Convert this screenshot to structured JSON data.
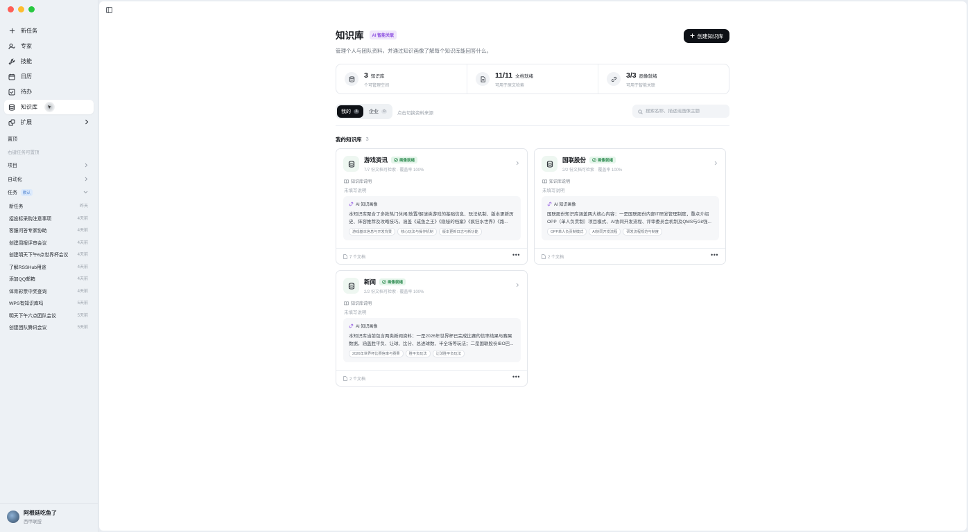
{
  "colors": {
    "accent": "#0e1116",
    "ai_purple": "#8a4ce0",
    "ready_green": "#2e8b50"
  },
  "sidebar": {
    "nav": [
      {
        "label": "新任务",
        "icon": "plus-icon"
      },
      {
        "label": "专家",
        "icon": "expert-icon"
      },
      {
        "label": "技能",
        "icon": "wrench-icon"
      },
      {
        "label": "日历",
        "icon": "calendar-icon"
      },
      {
        "label": "待办",
        "icon": "todo-check-icon"
      },
      {
        "label": "知识库",
        "icon": "database-icon",
        "active": true
      },
      {
        "label": "扩展",
        "icon": "extension-icon"
      }
    ],
    "pinned_label": "置顶",
    "pinned_hint": "右键任务可置顶",
    "projects_label": "项目",
    "automation_label": "自动化",
    "tasks_label": "任务",
    "tasks_badge": "默认",
    "tasks": [
      {
        "title": "新任务",
        "time": "昨天"
      },
      {
        "title": "招投标采购注意事项",
        "time": "4天前"
      },
      {
        "title": "客服问答专家协助",
        "time": "4天前"
      },
      {
        "title": "创建周报评审会议",
        "time": "4天前"
      },
      {
        "title": "创建明天下午6点世界杯会议",
        "time": "4天前"
      },
      {
        "title": "了解RSSHub用途",
        "time": "4天前"
      },
      {
        "title": "添加QQ邮箱",
        "time": "4天前"
      },
      {
        "title": "体育彩票中奖查询",
        "time": "4天前"
      },
      {
        "title": "WPS有知识库吗",
        "time": "5天前"
      },
      {
        "title": "明天下午六点团队会议",
        "time": "5天前"
      },
      {
        "title": "创建团队腾讯会议",
        "time": "5天前"
      }
    ],
    "user": {
      "name": "阿根廷吃鱼了",
      "org": "西甲联盟"
    }
  },
  "header": {
    "title": "知识库",
    "ai_badge": "AI 智能关联",
    "subtitle": "管理个人与团队资料，并通过知识画像了解每个知识库能回答什么。",
    "create_button": "创建知识库"
  },
  "stats": [
    {
      "num": "3",
      "label": "知识库",
      "sub": "个可管理空间",
      "icon": "database-icon"
    },
    {
      "num": "11/11",
      "label": "文档就绪",
      "sub": "可用于原文检索",
      "icon": "document-icon"
    },
    {
      "num": "3/3",
      "label": "画像就绪",
      "sub": "可用于智能关联",
      "icon": "link-icon"
    }
  ],
  "tabs": {
    "mine": {
      "label": "我的",
      "count": "3"
    },
    "enterprise": {
      "label": "企业",
      "count": "0"
    },
    "hint": "点击切换资料来源"
  },
  "search": {
    "placeholder": "搜索名称、描述或画像主题"
  },
  "section": {
    "title": "我的知识库",
    "count": "3"
  },
  "cards": [
    {
      "name": "游戏资讯",
      "status": "画像就绪",
      "meta": "7/7 份文档可检索 · 覆盖率 100%",
      "desc_label": "知识库说明",
      "desc": "未填写说明",
      "ai_label": "AI 知识画像",
      "summary": "本知识库聚合了多款热门休闲/放置/解谜类游戏的基础信息、玩法机制、版本更新历史、阵容推荐及攻略技巧。涵盖《咸鱼之王》《隐秘的档案》《疯狂水世界》《路...",
      "tags": [
        "游戏基本信息与开发背景",
        "核心玩法与操作机制",
        "版本更新日志与新功能"
      ],
      "docs": "7 个文档"
    },
    {
      "name": "国联股份",
      "status": "画像就绪",
      "meta": "2/2 份文档可检索 · 覆盖率 100%",
      "desc_label": "知识库说明",
      "desc": "未填写说明",
      "ai_label": "AI 知识画像",
      "summary": "国联股份知识库涵盖两大核心内容：一是国联股份内部IT研发管理制度，重点介绍OPP（单人负责制）项目模式、AI协同开发流程、评审委员会机制及QMS与Git强...",
      "tags": [
        "OPP单人负责制模式",
        "AI协同开发流程",
        "研发流程规范与制度"
      ],
      "docs": "2 个文档"
    },
    {
      "name": "新闻",
      "status": "画像就绪",
      "meta": "2/2 份文档可检索 · 覆盖率 100%",
      "desc_label": "知识库说明",
      "desc": "未填写说明",
      "ai_label": "AI 知识画像",
      "summary": "本知识库当前包含两类新闻资料：一是2026年世界杯已完成比赛的信率结果与赛果数据，涵盖胜平负、让球、比分、总进球数、半全场等玩法；二是国联股份IBO巴...",
      "tags": [
        "2026年世界杯比赛信率与赛果",
        "胜平负玩法",
        "让球胜平负玩法"
      ],
      "docs": "2 个文档"
    }
  ]
}
